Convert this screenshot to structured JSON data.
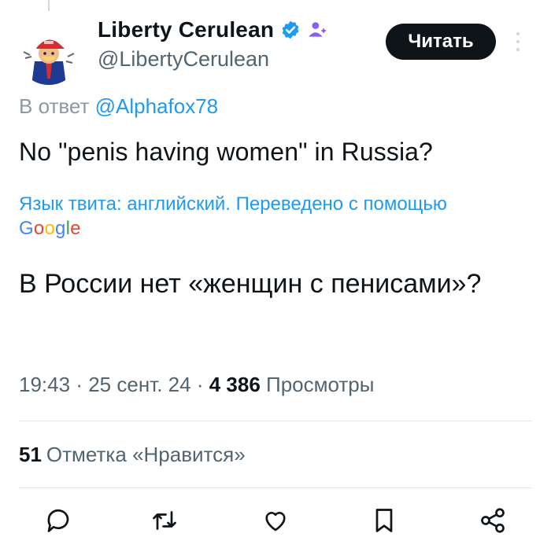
{
  "author": {
    "name": "Liberty Cerulean",
    "handle": "@LibertyCerulean",
    "avatar_icon": "cartoon-avatar-red-cap",
    "verified_icon": "verified-badge-icon",
    "affiliation_icon": "affiliation-person-icon"
  },
  "header": {
    "read_button_label": "Читать",
    "more_icon": "more-vertical-icon"
  },
  "reply": {
    "prefix": "В ответ",
    "mention": "@Alphafox78"
  },
  "tweet": {
    "text": "No \"penis having women\" in Russia?",
    "translation_note": "Язык твита: английский. Переведено с помощью",
    "translation_provider": "Google",
    "translated_text": "В России нет «женщин с пенисами»?"
  },
  "meta": {
    "time": "19:43",
    "separator": "·",
    "date": "25 сент. 24",
    "views_count": "4 386",
    "views_label": "Просмотры"
  },
  "engagement": {
    "likes_count": "51",
    "likes_label": "Отметка «Нравится»"
  },
  "actions": [
    "reply-icon",
    "retweet-icon",
    "like-icon",
    "bookmark-icon",
    "share-icon"
  ],
  "colors": {
    "accent": "#1d9bf0",
    "text": "#0f1419",
    "muted": "#536471",
    "button_bg": "#0f1419",
    "affiliation": "#8b5cf6"
  }
}
